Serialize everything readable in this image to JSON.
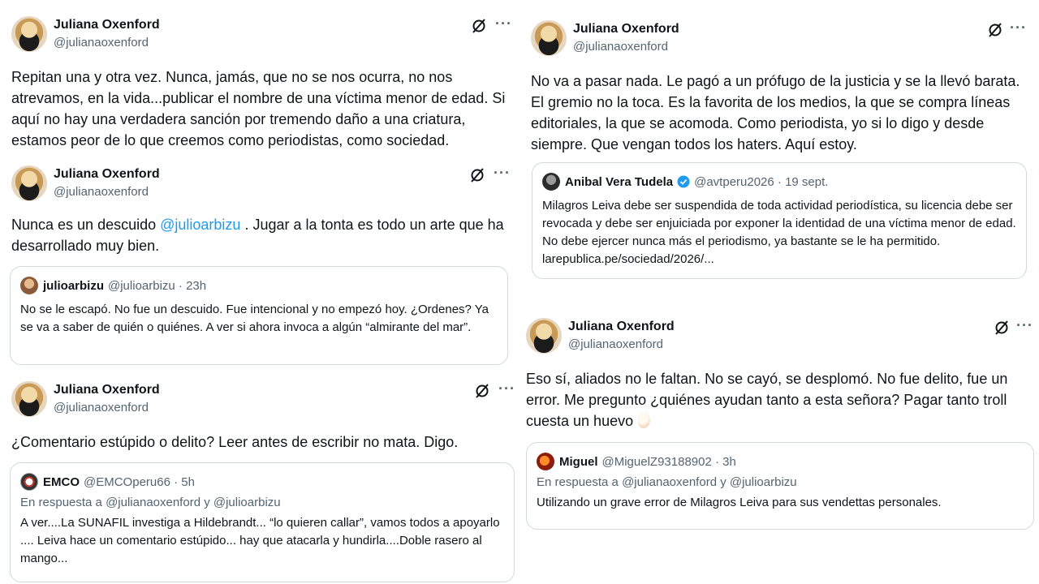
{
  "tweets": [
    {
      "author": "Juliana Oxenford",
      "handle": "@julianaoxenford",
      "text": "Repitan una y otra vez. Nunca, jamás, que no se nos ocurra, no nos atrevamos, en la vida...publicar el nombre de una víctima menor de edad. Si aquí no hay una verdadera sanción por tremendo daño a una criatura, estamos peor de lo que creemos como periodistas, como sociedad."
    },
    {
      "author": "Juliana Oxenford",
      "handle": "@julianaoxenford",
      "text_before": "Nunca es un descuido ",
      "mention": "@julioarbizu",
      "text_after": " . Jugar a la tonta es todo un arte que ha desarrollado muy bien.",
      "quote": {
        "author": "julioarbizu",
        "meta": "@julioarbizu · 23h",
        "text": "No se le escapó. No fue un descuido. Fue intencional y no empezó hoy. ¿Ordenes? Ya se va a saber de quién o quiénes. A ver si ahora invoca a algún “almirante del mar”."
      }
    },
    {
      "author": "Juliana Oxenford",
      "handle": "@julianaoxenford",
      "text": "¿Comentario estúpido o delito? Leer antes de escribir no mata. Digo.",
      "quote": {
        "author": "EMCO",
        "meta": "@EMCOperu66 · 5h",
        "reply": "En respuesta a @julianaoxenford y @julioarbizu",
        "text": "A ver....La SUNAFIL investiga a Hildebrandt... “lo quieren callar”, vamos todos a apoyarlo .... Leiva hace un comentario estúpido... hay que atacarla y hundirla....Doble rasero al mango..."
      }
    },
    {
      "author": "Juliana Oxenford",
      "handle": "@julianaoxenford",
      "text": "No va a pasar nada. Le pagó a un prófugo de la justicia y se la llevó barata. El gremio no la toca. Es la favorita de los medios, la que se compra líneas editoriales, la que se acomoda. Como periodista, yo si lo digo y desde siempre. Que vengan todos los haters. Aquí estoy.",
      "quote": {
        "author": "Anibal Vera Tudela",
        "meta": "@avtperu2026 · 19 sept.",
        "text": "Milagros Leiva debe ser suspendida de toda actividad periodística, su licencia debe ser revocada y debe ser enjuiciada por exponer la identidad de una víctima menor de edad. No debe ejercer nunca más el periodismo, ya bastante se le ha permitido. larepublica.pe/sociedad/2026/..."
      }
    },
    {
      "author": "Juliana Oxenford",
      "handle": "@julianaoxenford",
      "text": "Eso sí, aliados no le faltan. No se cayó, se desplomó. No fue delito, fue un error. Me pregunto ¿quiénes ayudan tanto a esta señora? Pagar tanto troll cuesta un huevo",
      "quote": {
        "author": "Miguel",
        "meta": "@MiguelZ93188902 · 3h",
        "reply": "En respuesta a @julianaoxenford y @julioarbizu",
        "text": "Utilizando un grave error de Milagros Leiva para sus vendettas personales."
      }
    }
  ],
  "icons": {
    "grok": "grok-icon",
    "more": "more-icon",
    "verified": "verified-badge-icon",
    "emoji": "egg-emoji-icon"
  },
  "colors": {
    "text": "#0f1419",
    "secondary": "#536471",
    "mention": "#1d9bf0",
    "border": "#cfd9de",
    "verified": "#1d9bf0"
  }
}
